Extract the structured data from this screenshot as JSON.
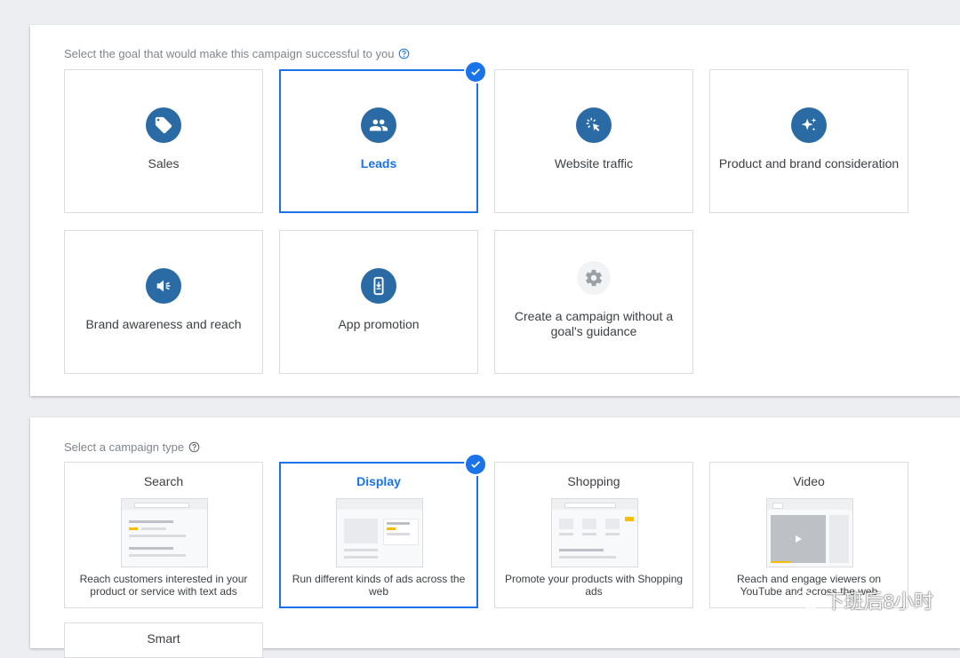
{
  "goal_section": {
    "label": "Select the goal that would make this campaign successful to you",
    "help_icon": "help-circle-icon",
    "goals": [
      {
        "label": "Sales",
        "icon": "tag-icon",
        "selected": false
      },
      {
        "label": "Leads",
        "icon": "people-icon",
        "selected": true
      },
      {
        "label": "Website traffic",
        "icon": "cursor-click-icon",
        "selected": false
      },
      {
        "label": "Product and brand consideration",
        "icon": "sparkle-icon",
        "selected": false
      },
      {
        "label": "Brand awareness and reach",
        "icon": "megaphone-icon",
        "selected": false
      },
      {
        "label": "App promotion",
        "icon": "phone-download-icon",
        "selected": false
      },
      {
        "label": "Create a campaign without a goal's guidance",
        "icon": "gear-icon",
        "selected": false
      }
    ]
  },
  "type_section": {
    "label": "Select a campaign type",
    "help_icon": "help-circle-icon",
    "types": [
      {
        "title": "Search",
        "description": "Reach customers interested in your product or service with text ads",
        "selected": false
      },
      {
        "title": "Display",
        "description": "Run different kinds of ads across the web",
        "selected": true
      },
      {
        "title": "Shopping",
        "description": "Promote your products with Shopping ads",
        "selected": false
      },
      {
        "title": "Video",
        "description": "Reach and engage viewers on YouTube and across the web",
        "selected": false
      },
      {
        "title": "Smart",
        "description": "",
        "selected": false
      }
    ]
  },
  "colors": {
    "accent": "#1a73e8",
    "icon_bg": "#2b6ba5",
    "highlight": "#fbbc04"
  },
  "watermark": "下班后8小时"
}
